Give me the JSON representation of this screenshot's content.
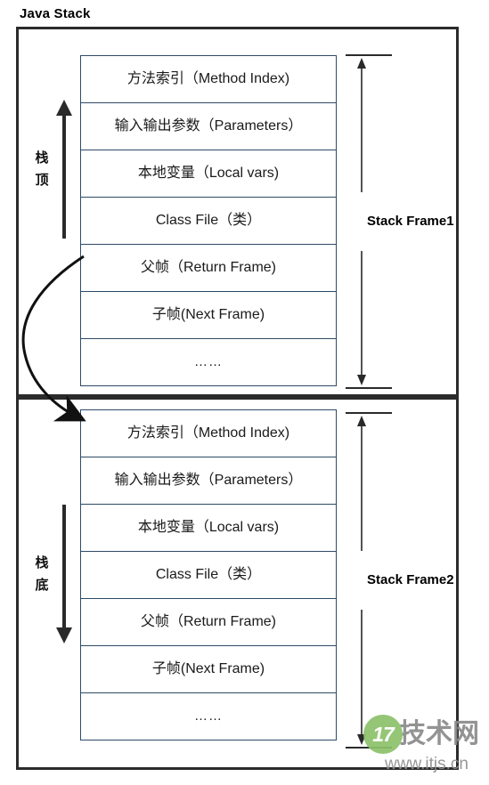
{
  "title": "Java Stack",
  "frames": [
    {
      "id": "frame1",
      "extent_label": "Stack Frame1",
      "side_label": "栈顶",
      "side_arrow_direction": "up",
      "rows": [
        "方法索引（Method Index)",
        "输入输出参数（Parameters）",
        "本地变量（Local vars)",
        "Class File（类）",
        "父帧（Return Frame)",
        "子帧(Next Frame)",
        "……"
      ]
    },
    {
      "id": "frame2",
      "extent_label": "Stack Frame2",
      "side_label": "栈底",
      "side_arrow_direction": "down",
      "rows": [
        "方法索引（Method Index)",
        "输入输出参数（Parameters）",
        "本地变量（Local vars)",
        "Class File（类）",
        "父帧（Return Frame)",
        "子帧(Next Frame)",
        "……"
      ]
    }
  ],
  "connector": {
    "name": "return-frame-to-next-frame-arrow",
    "from": "父帧（Return Frame)",
    "to": "Stack Frame2"
  },
  "watermark": {
    "badge": "17",
    "site_name": "技术网",
    "url": "www.itjs.cn"
  },
  "colors": {
    "outer_border": "#2b2b2b",
    "table_border": "#2e4a66",
    "text": "#1a1a1a",
    "arrow": "#1c1c1c",
    "watermark_green": "#8cc26a",
    "watermark_gray": "#8f8f8f",
    "background": "#ffffff"
  }
}
